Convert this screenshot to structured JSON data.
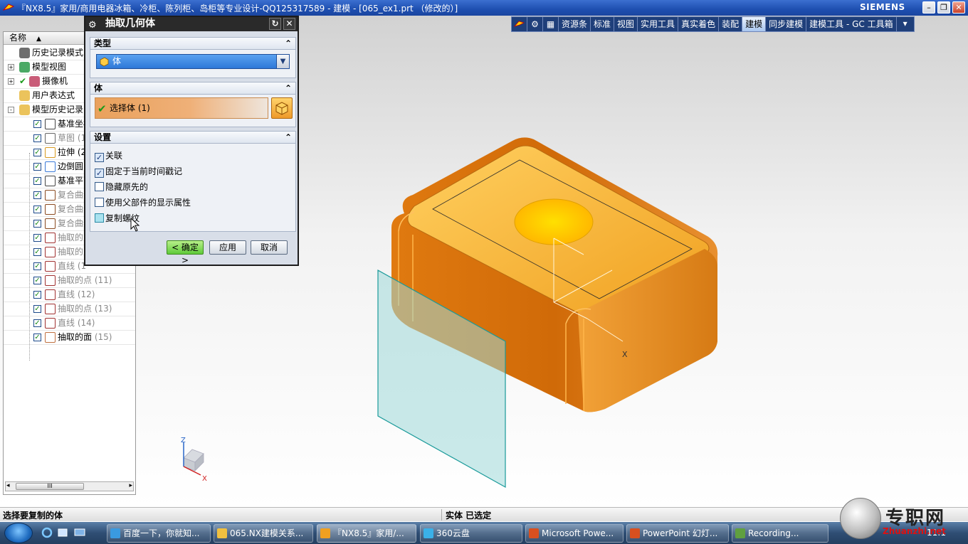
{
  "window": {
    "title": "『NX8.5』家用/商用电器冰箱、冷柜、陈列柜、岛柜等专业设计-QQ125317589 - 建模 - [065_ex1.prt （修改的）]",
    "brand": "SIEMENS"
  },
  "toolbar": {
    "items": [
      "资源条",
      "标准",
      "视图",
      "实用工具",
      "真实着色",
      "装配",
      "建模",
      "同步建模",
      "建模工具 - GC 工具箱"
    ],
    "active": "建模"
  },
  "navigator": {
    "column_header": "名称",
    "rows": [
      {
        "label": "历史记录模式",
        "icon": "clock-icon"
      },
      {
        "label": "模型视图",
        "icon": "view-icon"
      },
      {
        "label": "摄像机",
        "icon": "camera-icon"
      },
      {
        "label": "用户表达式",
        "icon": "folder-icon"
      },
      {
        "label": "模型历史记录",
        "icon": "folder-icon"
      },
      {
        "label": "基准坐标",
        "num": "",
        "icon": "datum-csys-icon"
      },
      {
        "label": "草图 (1",
        "num": "",
        "icon": "sketch-icon"
      },
      {
        "label": "拉伸 (2",
        "num": "",
        "icon": "extrude-icon"
      },
      {
        "label": "边倒圆",
        "num": "",
        "icon": "edge-blend-icon"
      },
      {
        "label": "基准平面",
        "num": "",
        "icon": "datum-plane-icon"
      },
      {
        "label": "复合曲线",
        "num": "",
        "icon": "composite-curve-icon"
      },
      {
        "label": "复合曲线",
        "num": "",
        "icon": "composite-curve-icon"
      },
      {
        "label": "复合曲线",
        "num": "",
        "icon": "composite-curve-icon"
      },
      {
        "label": "抽取的点",
        "num": "",
        "icon": "point-icon"
      },
      {
        "label": "抽取的点",
        "num": "",
        "icon": "point-icon"
      },
      {
        "label": "直线 (1",
        "num": "",
        "icon": "line-icon"
      },
      {
        "label": "抽取的点",
        "num": "(11)",
        "icon": "point-icon"
      },
      {
        "label": "直线",
        "num": "(12)",
        "icon": "line-icon"
      },
      {
        "label": "抽取的点",
        "num": "(13)",
        "icon": "point-icon"
      },
      {
        "label": "直线",
        "num": "(14)",
        "icon": "line-icon"
      },
      {
        "label": "抽取的面",
        "num": "(15)",
        "icon": "extract-face-icon"
      }
    ]
  },
  "dialog": {
    "title": "抽取几何体",
    "type_section": "类型",
    "type_value": "体",
    "body_section": "体",
    "select_body": "选择体 (1)",
    "settings_section": "设置",
    "options": [
      {
        "label": "关联",
        "checked": true
      },
      {
        "label": "固定于当前时间戳记",
        "checked": true
      },
      {
        "label": "隐藏原先的",
        "checked": false
      },
      {
        "label": "使用父部件的显示属性",
        "checked": false
      },
      {
        "label": "复制螺纹",
        "checked": false
      }
    ],
    "ok_label": "< 确定 >",
    "apply_label": "应用",
    "cancel_label": "取消"
  },
  "statusbar": {
    "prompt": "选择要复制的体",
    "status": "实体 已选定"
  },
  "taskbar": {
    "tasks": [
      {
        "label": "百度一下，你就知...",
        "icon": "ie-icon"
      },
      {
        "label": "065.NX建模关系...",
        "icon": "folder-icon"
      },
      {
        "label": "『NX8.5』家用/...",
        "icon": "nx-icon"
      },
      {
        "label": "360云盘",
        "icon": "cloud-icon"
      },
      {
        "label": "Microsoft Powe...",
        "icon": "powerpoint-icon"
      },
      {
        "label": "PowerPoint 幻灯...",
        "icon": "powerpoint-icon"
      },
      {
        "label": "Recording...",
        "icon": "recorder-icon"
      }
    ],
    "clock": "11:1"
  },
  "watermark": {
    "text": "专职网",
    "url": "Zhuanzhi.net"
  },
  "viewport": {
    "axis_labels": {
      "z": "Z",
      "x": "X"
    }
  },
  "colors": {
    "model_orange": "#f0a020",
    "plane_teal": "#9fd8d8",
    "titlebar_blue": "#1e4fb0",
    "dialog_title": "#2a2a2a"
  }
}
